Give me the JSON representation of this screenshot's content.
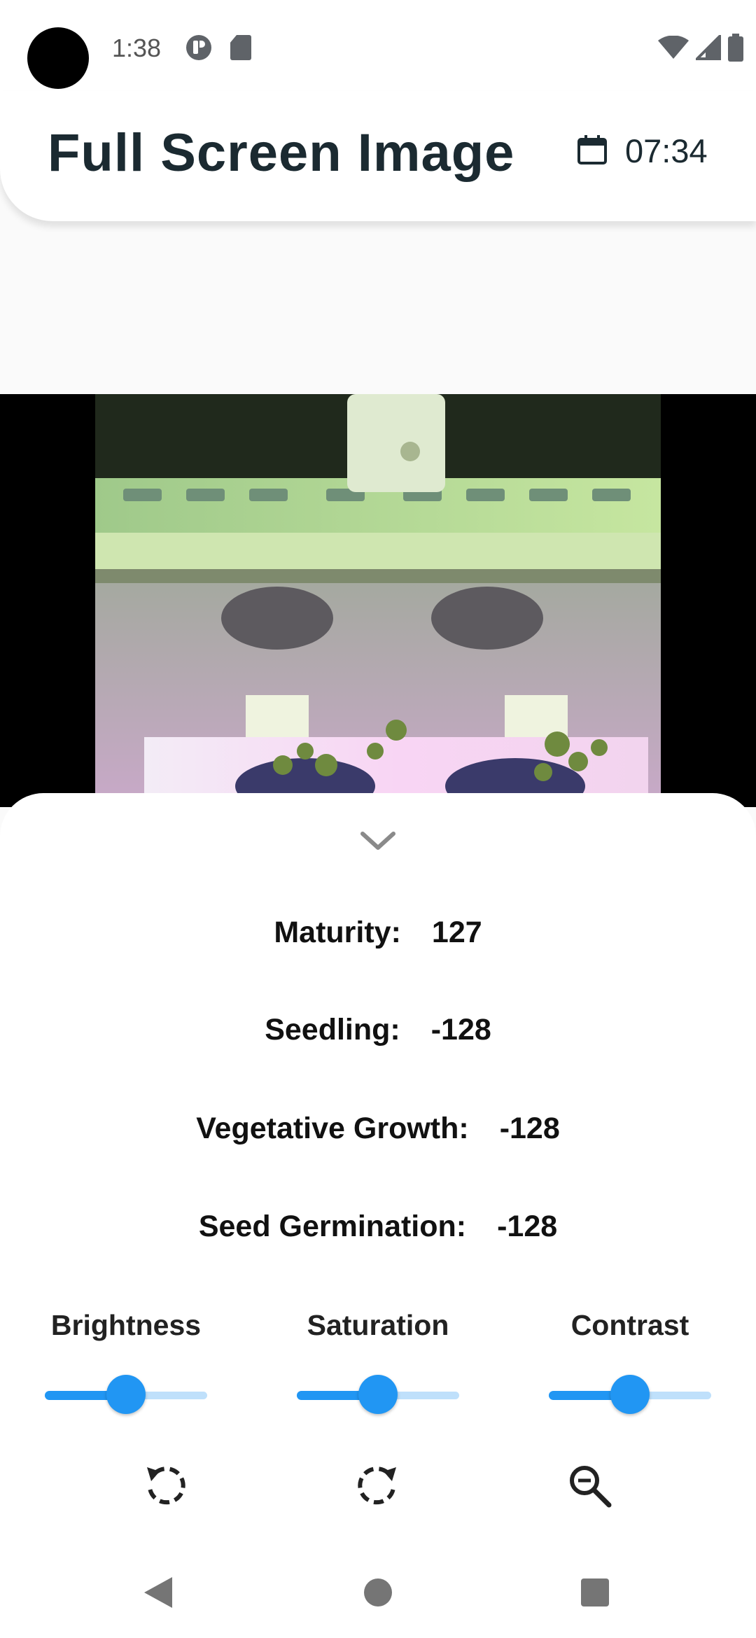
{
  "status_bar": {
    "time": "1:38",
    "icons": [
      "notification-p-icon",
      "sd-card-icon",
      "wifi-icon",
      "cell-signal-icon",
      "battery-icon"
    ]
  },
  "header": {
    "title": "Full Screen Image",
    "calendar_icon": "calendar-icon",
    "time": "07:34"
  },
  "image": {
    "description_icon": "plant-photo"
  },
  "sheet": {
    "collapse_icon": "chevron-down-icon",
    "stats": [
      {
        "label": "Maturity:",
        "value": "127"
      },
      {
        "label": "Seedling:",
        "value": "-128"
      },
      {
        "label": "Vegetative Growth:",
        "value": "-128"
      },
      {
        "label": "Seed Germination:",
        "value": "-128"
      }
    ],
    "sliders": [
      {
        "label": "Brightness",
        "level": 0.5
      },
      {
        "label": "Saturation",
        "level": 0.5
      },
      {
        "label": "Contrast",
        "level": 0.5
      }
    ],
    "tools": [
      "rotate-left-icon",
      "rotate-right-icon",
      "zoom-out-icon"
    ]
  },
  "nav": {
    "icons": [
      "back-icon",
      "home-icon",
      "recents-icon"
    ]
  },
  "colors": {
    "accent": "#2196f3",
    "accent_light": "#bfe0fb",
    "title": "#1b2a31"
  }
}
